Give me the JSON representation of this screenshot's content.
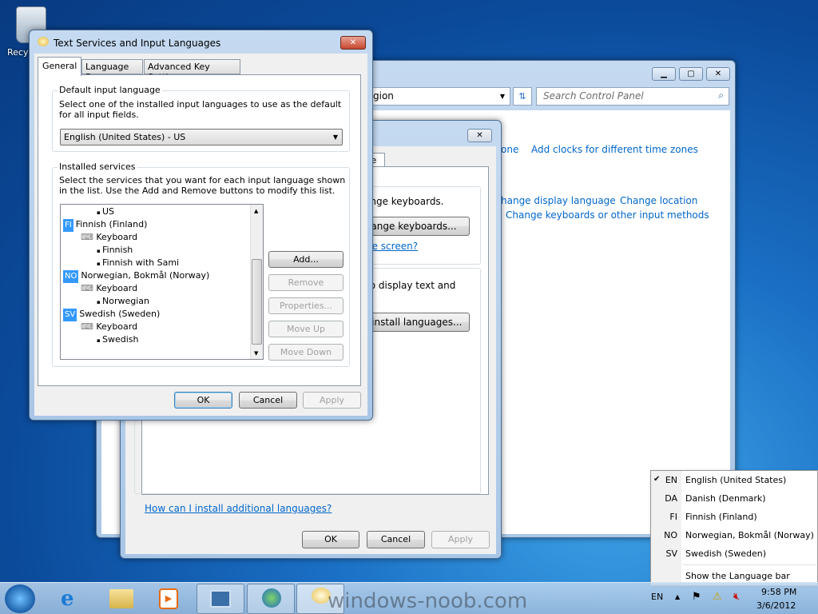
{
  "desktop": {
    "recycle_label": "Recyc"
  },
  "control_panel": {
    "address": "gion",
    "search_placeholder": "Search Control Panel",
    "links": [
      "one",
      "Add clocks for different time zones",
      "hange display language",
      "Change location",
      "Change keyboards or other input methods"
    ]
  },
  "region_dialog": {
    "tab": "ve",
    "text1": "ange keyboards.",
    "button1": "ange keyboards...",
    "link1": "he screen?",
    "text2": "to display text and",
    "button2": "ninstall languages...",
    "link_bottom": "How can I install additional languages?",
    "ok": "OK",
    "cancel": "Cancel",
    "apply": "Apply"
  },
  "text_services": {
    "title": "Text Services and Input Languages",
    "tabs": [
      "General",
      "Language Bar",
      "Advanced Key Settings"
    ],
    "default_group": {
      "label": "Default input language",
      "description": "Select one of the installed input languages to use as the default for all input fields.",
      "selected": "English (United States) - US"
    },
    "installed_group": {
      "label": "Installed services",
      "description": "Select the services that you want for each input language shown in the list. Use the Add and Remove buttons to modify this list."
    },
    "tree": [
      {
        "text": "US",
        "level": 2
      },
      {
        "tag": "FI",
        "text": "Finnish (Finland)",
        "level": 0
      },
      {
        "text": "Keyboard",
        "level": 1
      },
      {
        "text": "Finnish",
        "level": 2
      },
      {
        "text": "Finnish with Sami",
        "level": 2
      },
      {
        "tag": "NO",
        "text": "Norwegian, Bokmål (Norway)",
        "level": 0
      },
      {
        "text": "Keyboard",
        "level": 1
      },
      {
        "text": "Norwegian",
        "level": 2
      },
      {
        "tag": "SV",
        "text": "Swedish (Sweden)",
        "level": 0
      },
      {
        "text": "Keyboard",
        "level": 1
      },
      {
        "text": "Swedish",
        "level": 2
      }
    ],
    "side_buttons": [
      {
        "label": "Add...",
        "enabled": true
      },
      {
        "label": "Remove",
        "enabled": false
      },
      {
        "label": "Properties...",
        "enabled": false
      },
      {
        "label": "Move Up",
        "enabled": false
      },
      {
        "label": "Move Down",
        "enabled": false
      }
    ],
    "ok": "OK",
    "cancel": "Cancel",
    "apply": "Apply"
  },
  "language_menu": {
    "items": [
      {
        "code": "EN",
        "name": "English (United States)",
        "checked": true
      },
      {
        "code": "DA",
        "name": "Danish (Denmark)",
        "checked": false
      },
      {
        "code": "FI",
        "name": "Finnish (Finland)",
        "checked": false
      },
      {
        "code": "NO",
        "name": "Norwegian, Bokmål (Norway)",
        "checked": false
      },
      {
        "code": "SV",
        "name": "Swedish (Sweden)",
        "checked": false
      }
    ],
    "show_bar": "Show the Language bar",
    "check": "✔"
  },
  "taskbar": {
    "lang": "EN",
    "time": "9:58 PM",
    "date": "3/6/2012",
    "watermark": "windows-noob.com"
  }
}
